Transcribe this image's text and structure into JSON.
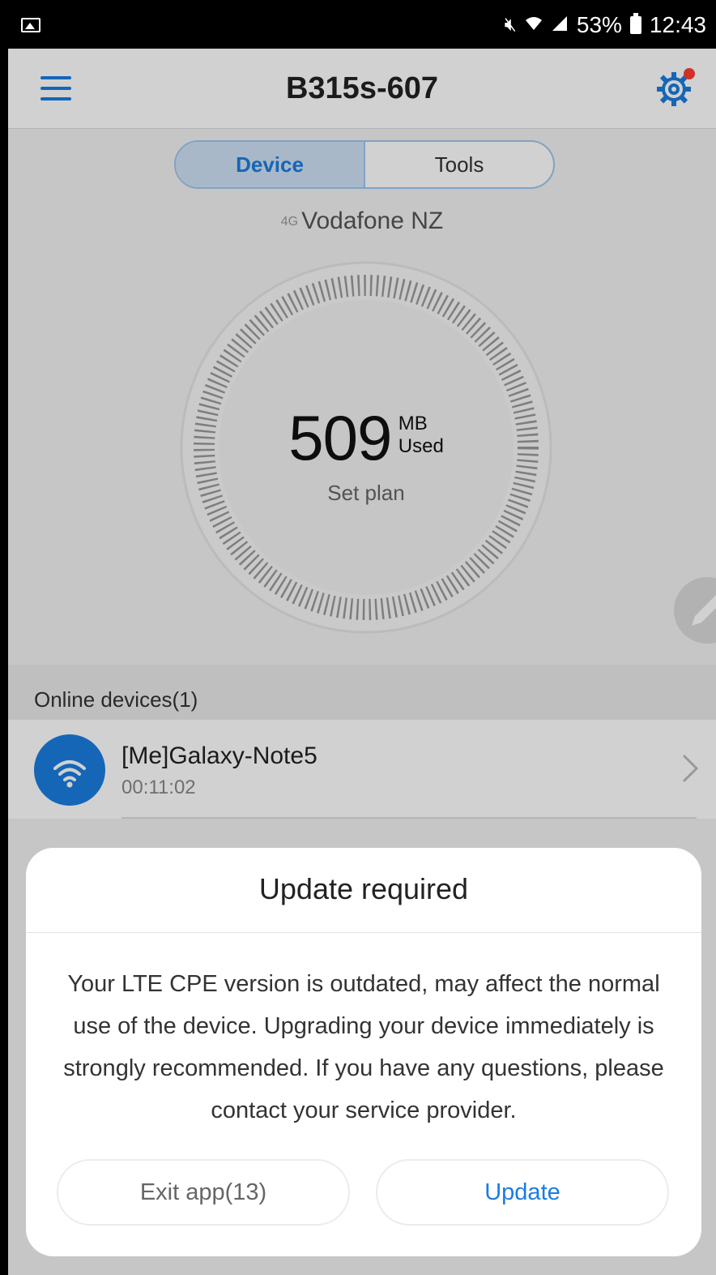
{
  "status_bar": {
    "battery": "53%",
    "time": "12:43",
    "icons": [
      "gallery-icon",
      "mute-icon",
      "wifi-icon",
      "signal-icon",
      "battery-icon"
    ]
  },
  "app_bar": {
    "title": "B315s-607",
    "icons": [
      "menu-icon",
      "gear-icon"
    ],
    "notification_dot_color": "#ff3b30"
  },
  "tabs": [
    {
      "label": "Device",
      "active": true
    },
    {
      "label": "Tools",
      "active": false
    }
  ],
  "network": {
    "signal_label": "4G",
    "name": "Vodafone NZ"
  },
  "usage": {
    "value": "509",
    "unit": "MB",
    "unit_sub": "Used",
    "action": "Set plan"
  },
  "online_devices": {
    "header": "Online devices(1)",
    "items": [
      {
        "name": "[Me]Galaxy-Note5",
        "time": "00:11:02",
        "icon": "wifi-icon"
      }
    ]
  },
  "dialog": {
    "title": "Update required",
    "message": "Your LTE CPE version is outdated, may affect the normal use of the device. Upgrading your device immediately is strongly recommended. If you have any questions, please contact your service provider.",
    "exit_label": "Exit app(13)",
    "update_label": "Update"
  },
  "colors": {
    "accent": "#1a7de0"
  }
}
